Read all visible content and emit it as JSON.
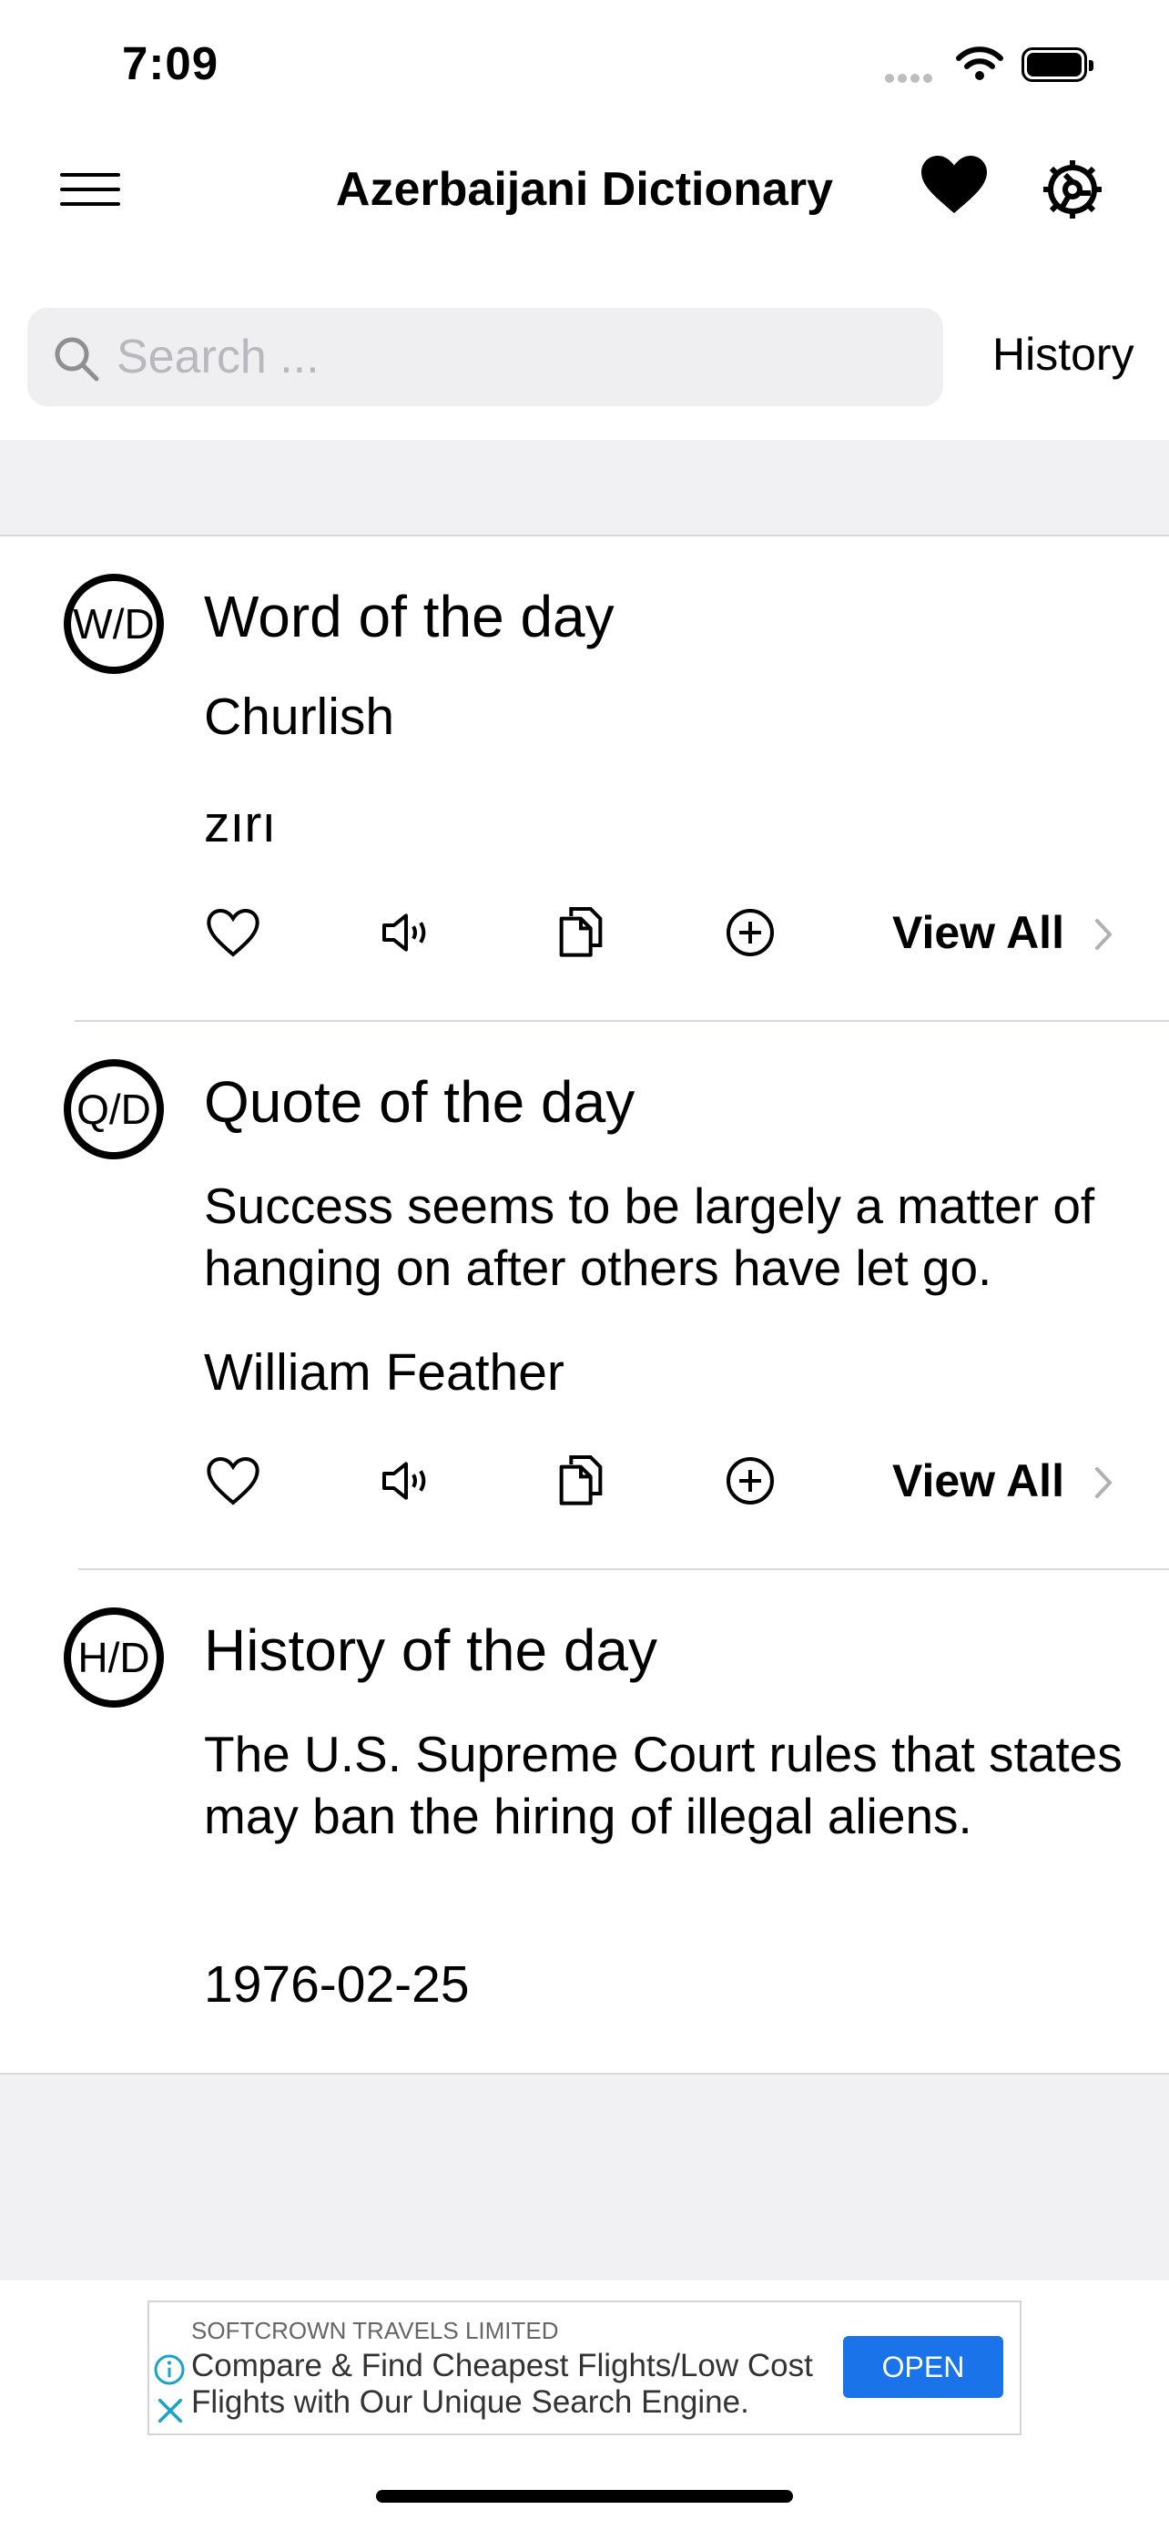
{
  "status_bar": {
    "time": "7:09"
  },
  "nav": {
    "title": "Azerbaijani Dictionary"
  },
  "search": {
    "placeholder": "Search ...",
    "history_label": "History"
  },
  "cards": {
    "word": {
      "badge": "W/D",
      "title": "Word of the day",
      "word": "Churlish",
      "translation": "zırı",
      "view_all": "View All"
    },
    "quote": {
      "badge": "Q/D",
      "title": "Quote of the day",
      "text": "Success seems to be largely a matter of hanging on after others have let go.",
      "author": "William Feather",
      "view_all": "View All"
    },
    "history": {
      "badge": "H/D",
      "title": "History of the day",
      "text": "The U.S. Supreme Court rules that states may ban the hiring of illegal aliens.",
      "date": "1976-02-25"
    }
  },
  "ad": {
    "sponsor": "SOFTCROWN TRAVELS LIMITED",
    "text": "Compare & Find Cheapest Flights/Low Cost Flights with Our Unique Search Engine.",
    "button": "OPEN"
  },
  "colors": {
    "accent": "#1a73e8",
    "grey_bg": "#f1f1f4",
    "divider": "#d8d8dc"
  },
  "icons": [
    "menu-icon",
    "heart-icon",
    "gear-icon",
    "search-icon",
    "heart-outline-icon",
    "speaker-icon",
    "copy-icon",
    "plus-circle-icon",
    "chevron-right-icon",
    "info-icon",
    "close-icon",
    "wifi-icon",
    "battery-icon",
    "signal-icon"
  ]
}
